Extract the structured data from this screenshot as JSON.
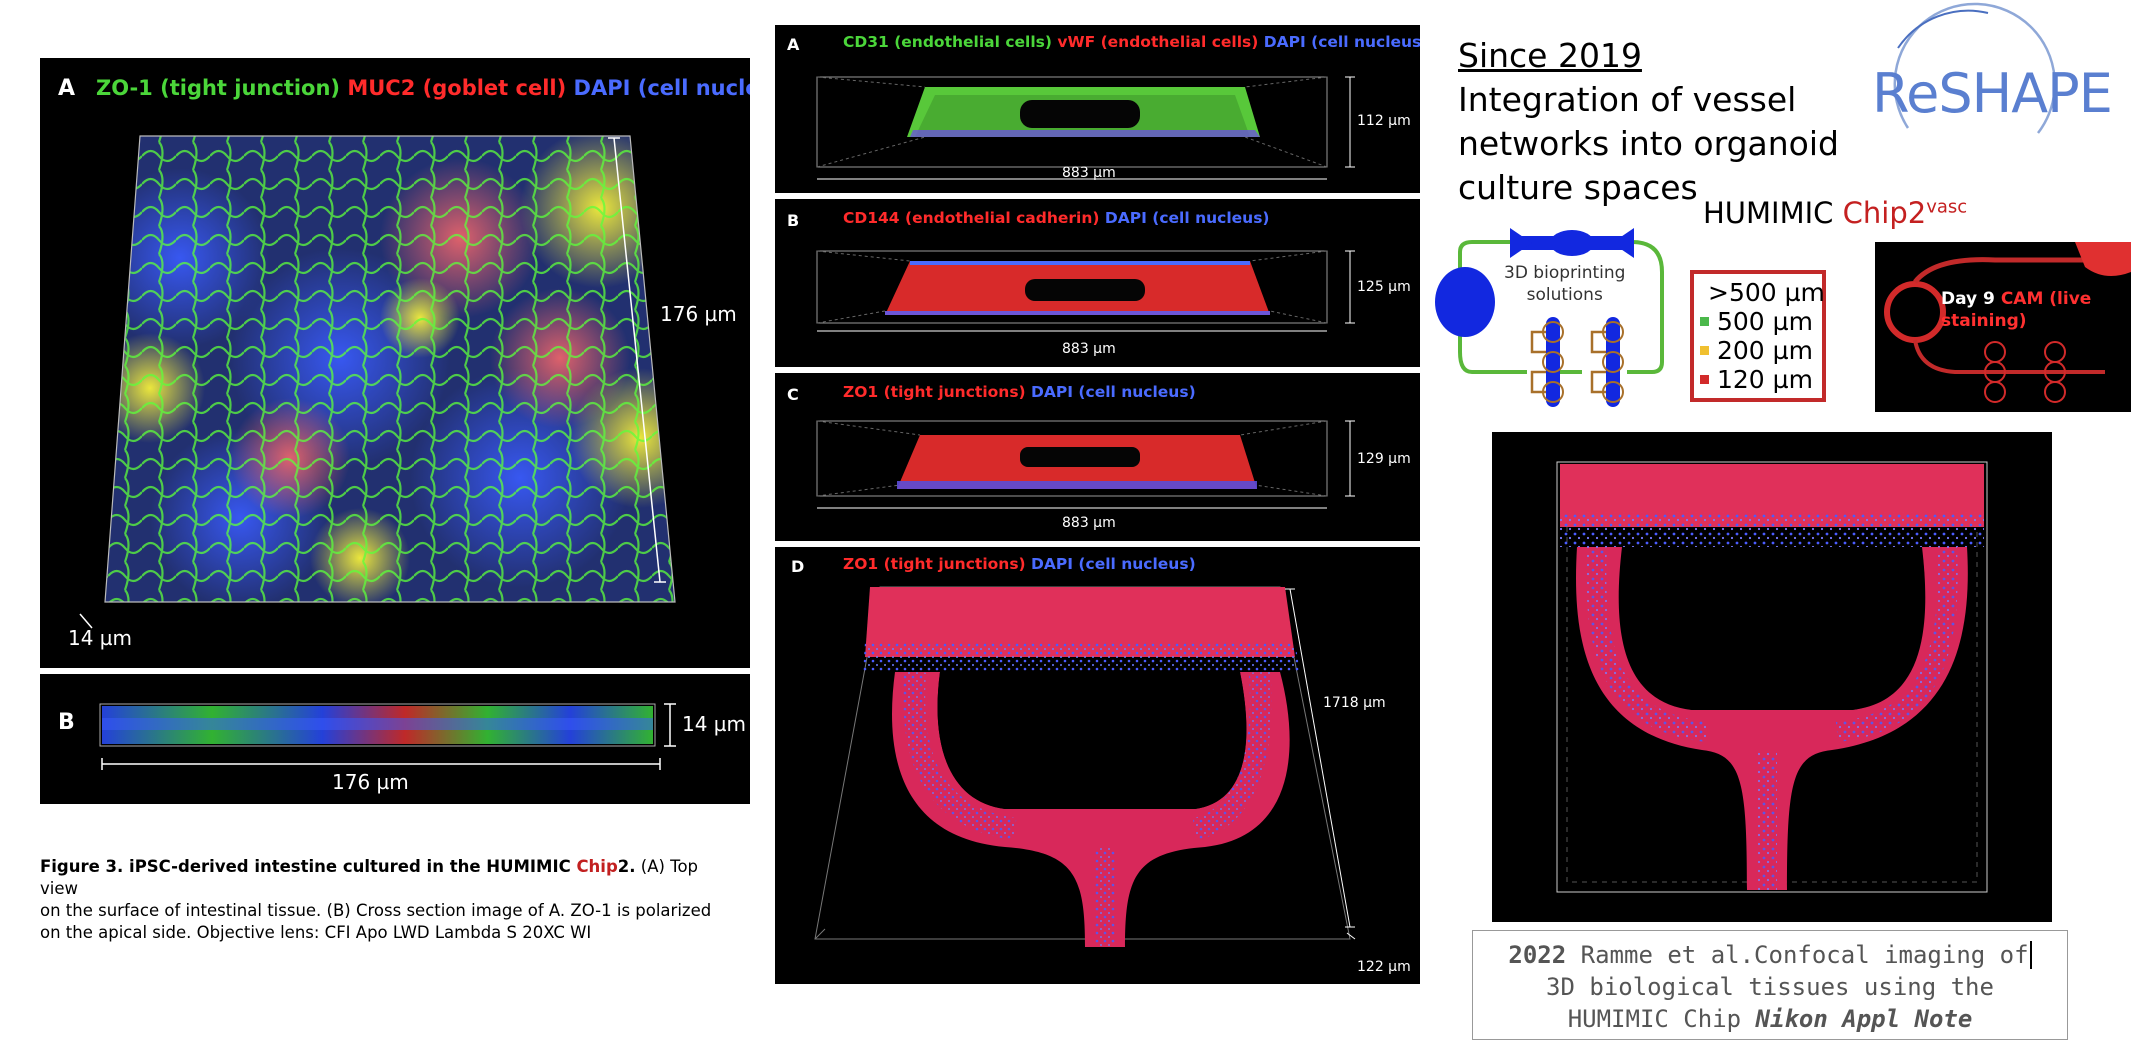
{
  "left_figure": {
    "panel_a": {
      "letter": "A",
      "legend": [
        {
          "text": "ZO-1 (tight junction)",
          "color": "#4bd63a"
        },
        {
          "text": "MUC2 (goblet cell)",
          "color": "#ff2b2b"
        },
        {
          "text": "DAPI (cell nucleus)",
          "color": "#4a6bff"
        }
      ],
      "scale_side": "176 µm",
      "scale_depth": "14 µm"
    },
    "panel_b": {
      "letter": "B",
      "scale_height": "14 µm",
      "scale_width": "176 µm"
    },
    "caption": {
      "bold_prefix": "Figure 3. iPSC-derived intestine cultured in the HUMIMIC ",
      "chip_word": "Chip",
      "bold_suffix": "2.",
      "line1_rest": " (A) Top view",
      "line2": "on the surface of intestinal tissue. (B) Cross section image of A. ZO-1 is polarized",
      "line3": "on the apical side. Objective lens: CFI Apo LWD Lambda S 20XC WI"
    }
  },
  "middle_figure": {
    "panel_a": {
      "letter": "A",
      "legend": [
        {
          "text": "CD31 (endothelial cells)",
          "color": "#4bd63a"
        },
        {
          "text": "vWF (endothelial cells)",
          "color": "#ff2b2b"
        },
        {
          "text": "DAPI (cell nucleus)",
          "color": "#4a6bff"
        }
      ],
      "height": "112 µm",
      "width": "883 µm"
    },
    "panel_b": {
      "letter": "B",
      "legend": [
        {
          "text": "CD144 (endothelial cadherin)",
          "color": "#ff2b2b"
        },
        {
          "text": "DAPI (cell nucleus)",
          "color": "#4a6bff"
        }
      ],
      "height": "125 µm",
      "width": "883 µm"
    },
    "panel_c": {
      "letter": "C",
      "legend": [
        {
          "text": "ZO1 (tight junctions)",
          "color": "#ff2b2b"
        },
        {
          "text": "DAPI (cell nucleus)",
          "color": "#4a6bff"
        }
      ],
      "height": "129 µm",
      "width": "883 µm"
    },
    "panel_d": {
      "letter": "D",
      "legend": [
        {
          "text": "ZO1 (tight junctions)",
          "color": "#ff2b2b"
        },
        {
          "text": "DAPI (cell nucleus)",
          "color": "#4a6bff"
        }
      ],
      "side": "1718 µm",
      "depth": "122 µm"
    }
  },
  "right": {
    "since": "Since 2019",
    "headline_lines": [
      "Integration of vessel",
      "networks into organoid",
      "culture spaces"
    ],
    "logo_text": "ReSHAPE",
    "humimic_prefix": "HUMIMIC ",
    "humimic_chip": "Chip2",
    "humimic_sup": "vasc",
    "bioprint_lines": [
      "3D bioprinting",
      "solutions"
    ],
    "size_legend": [
      {
        "text": ">500 µm",
        "color": "#1a2bd6"
      },
      {
        "text": "500 µm",
        "color": "#4bb84b"
      },
      {
        "text": "200 µm",
        "color": "#f0c030"
      },
      {
        "text": "120 µm",
        "color": "#d22b2b"
      }
    ],
    "cam_day": "Day 9 ",
    "cam_lines": [
      "CAM (live",
      "staining)"
    ],
    "ref": {
      "year": "2022",
      "line1_rest": " Ramme et al.Confocal imaging of",
      "line2": "3D biological tissues using the",
      "line3_plain": "HUMIMIC Chip ",
      "line3_em": "Nikon Appl Note"
    }
  }
}
